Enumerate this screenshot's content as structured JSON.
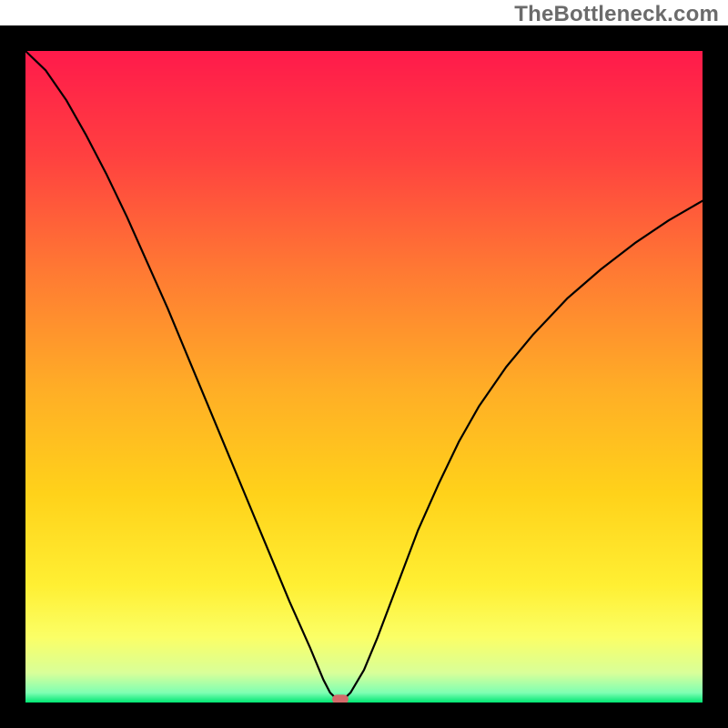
{
  "watermark": "TheBottleneck.com",
  "chart_data": {
    "type": "line",
    "title": "",
    "xlabel": "",
    "ylabel": "",
    "xlim": [
      0,
      100
    ],
    "ylim": [
      0,
      100
    ],
    "grid": false,
    "background_gradient": {
      "stops": [
        {
          "offset": 0.0,
          "color": "#ff1a4b"
        },
        {
          "offset": 0.16,
          "color": "#ff4040"
        },
        {
          "offset": 0.34,
          "color": "#ff7a33"
        },
        {
          "offset": 0.52,
          "color": "#ffae26"
        },
        {
          "offset": 0.68,
          "color": "#ffd21a"
        },
        {
          "offset": 0.82,
          "color": "#ffef33"
        },
        {
          "offset": 0.9,
          "color": "#fbff66"
        },
        {
          "offset": 0.955,
          "color": "#d8ff99"
        },
        {
          "offset": 0.985,
          "color": "#7fffb3"
        },
        {
          "offset": 1.0,
          "color": "#00e673"
        }
      ]
    },
    "series": [
      {
        "name": "bottleneck-curve",
        "color": "#000000",
        "stroke_width": 2.2,
        "x": [
          0,
          3,
          6,
          9,
          12,
          15,
          18,
          21,
          24,
          27,
          30,
          33,
          35,
          37,
          39,
          40.5,
          42,
          43,
          44,
          45,
          46,
          47,
          48,
          50,
          52,
          54,
          56,
          58,
          61,
          64,
          67,
          71,
          75,
          80,
          85,
          90,
          95,
          100
        ],
        "y": [
          100,
          97,
          92.5,
          87,
          81,
          74.5,
          67.5,
          60.5,
          53,
          45.5,
          38,
          30.5,
          25.5,
          20.5,
          15.5,
          12,
          8.5,
          6,
          3.5,
          1.5,
          0.5,
          0.5,
          1.5,
          5,
          10,
          15.5,
          21,
          26.5,
          33.5,
          40,
          45.5,
          51.5,
          56.5,
          62,
          66.5,
          70.5,
          74,
          77
        ]
      }
    ],
    "marker": {
      "name": "optimal-point",
      "x": 46.5,
      "y": 0.5,
      "width": 2.4,
      "height": 1.4,
      "rx": 0.7,
      "color": "#d46a6a"
    },
    "frame": {
      "border_color": "#000000",
      "border_width": 28
    }
  }
}
